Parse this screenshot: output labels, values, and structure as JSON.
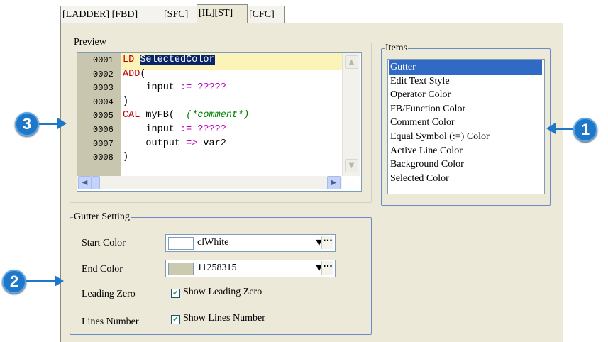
{
  "tabs": [
    "[LADDER] [FBD]",
    "[SFC]",
    "[IL][ST]",
    "[CFC]"
  ],
  "active_tab_index": 2,
  "preview": {
    "legend": "Preview",
    "lines": [
      {
        "num": "0001",
        "parts": [
          {
            "t": "LD",
            "c": "kw"
          },
          {
            "t": " "
          },
          {
            "t": "SelectedColor",
            "c": "sel"
          }
        ]
      },
      {
        "num": "0002",
        "parts": [
          {
            "t": "ADD",
            "c": "kw"
          },
          {
            "t": "("
          }
        ]
      },
      {
        "num": "0003",
        "parts": [
          {
            "t": "    input "
          },
          {
            "t": ":=",
            "c": "op"
          },
          {
            "t": " "
          },
          {
            "t": "?????",
            "c": "op"
          }
        ]
      },
      {
        "num": "0004",
        "parts": [
          {
            "t": ")"
          }
        ]
      },
      {
        "num": "0005",
        "parts": [
          {
            "t": "CAL",
            "c": "kw"
          },
          {
            "t": " myFB(  "
          },
          {
            "t": "(*comment*)",
            "c": "cm"
          }
        ]
      },
      {
        "num": "0006",
        "parts": [
          {
            "t": "    input "
          },
          {
            "t": ":=",
            "c": "op"
          },
          {
            "t": " "
          },
          {
            "t": "?????",
            "c": "op"
          }
        ]
      },
      {
        "num": "0007",
        "parts": [
          {
            "t": "    output "
          },
          {
            "t": "=>",
            "c": "op"
          },
          {
            "t": " var2"
          }
        ]
      },
      {
        "num": "0008",
        "parts": [
          {
            "t": ")"
          }
        ]
      }
    ]
  },
  "items": {
    "legend": "Items",
    "list": [
      "Gutter",
      "Edit Text Style",
      "Operator Color",
      "FB/Function Color",
      "Comment Color",
      "Equal Symbol (:=) Color",
      "Active Line Color",
      "Background Color",
      "Selected Color"
    ],
    "selected_index": 0
  },
  "gutter_setting": {
    "legend": "Gutter Setting",
    "start_color_label": "Start Color",
    "start_color_value": "clWhite",
    "start_color_swatch": "#ffffff",
    "end_color_label": "End Color",
    "end_color_value": "11258315",
    "end_color_swatch": "#cbc9b0",
    "leading_zero_label": "Leading Zero",
    "leading_zero_checkbox": "Show Leading Zero",
    "leading_zero_checked": true,
    "lines_number_label": "Lines Number",
    "lines_number_checkbox": "Show Lines Number",
    "lines_number_checked": true
  },
  "callouts": {
    "one": "1",
    "two": "2",
    "three": "3"
  },
  "colors": {
    "callout": "#1f77c8",
    "keyword": "#c00000",
    "operator": "#c000c0",
    "comment": "#008000",
    "selection": "#0a246a"
  }
}
